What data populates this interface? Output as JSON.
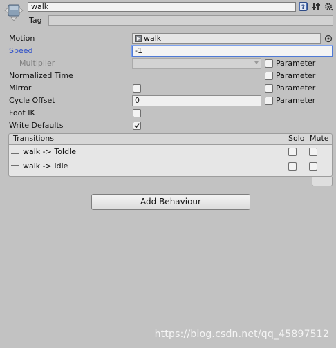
{
  "header": {
    "state_name": "walk",
    "tag_label": "Tag",
    "tag_value": ""
  },
  "fields": {
    "motion_label": "Motion",
    "motion_value": "walk",
    "speed_label": "Speed",
    "speed_value": "-1",
    "multiplier_label": "Multiplier",
    "multiplier_value": "",
    "normalized_time_label": "Normalized Time",
    "mirror_label": "Mirror",
    "cycle_offset_label": "Cycle Offset",
    "cycle_offset_value": "0",
    "foot_ik_label": "Foot IK",
    "write_defaults_label": "Write Defaults",
    "parameter_label": "Parameter"
  },
  "checkbox_states": {
    "multiplier_parameter": false,
    "normalized_time_parameter": false,
    "mirror": false,
    "mirror_parameter": false,
    "cycle_offset_parameter": false,
    "foot_ik": false,
    "write_defaults": true
  },
  "transitions": {
    "header": "Transitions",
    "solo_label": "Solo",
    "mute_label": "Mute",
    "items": [
      {
        "label": "walk -> ToIdle",
        "solo": false,
        "mute": false
      },
      {
        "label": "walk -> Idle",
        "solo": false,
        "mute": false
      }
    ]
  },
  "add_behaviour_label": "Add Behaviour",
  "watermark": "https://blog.csdn.net/qq_45897512",
  "colors": {
    "background": "#c2c2c2",
    "speed_label": "#2c4ec9",
    "focus_border": "#4f7ad6"
  }
}
